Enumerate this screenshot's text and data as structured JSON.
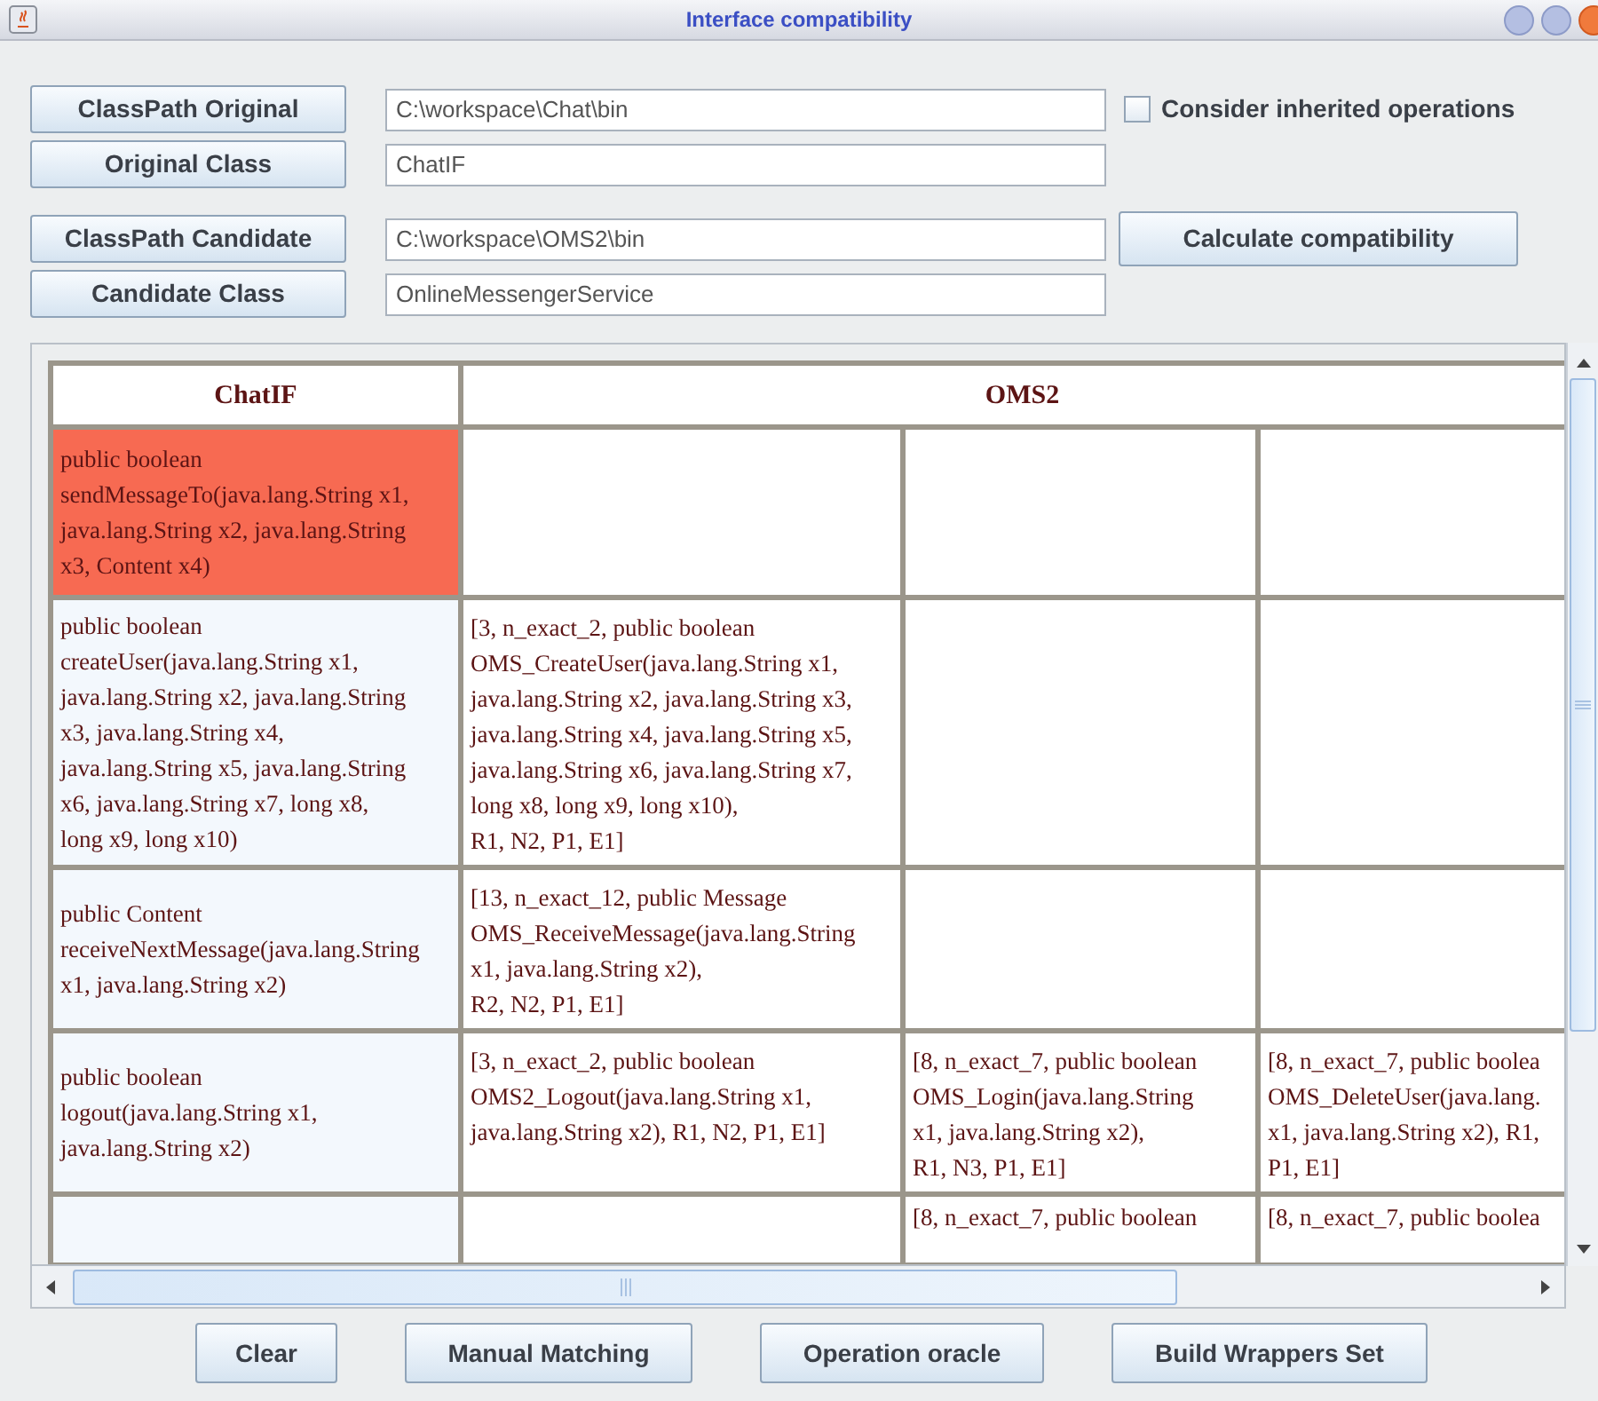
{
  "window": {
    "title": "Interface compatibility"
  },
  "form": [
    {
      "button": "ClassPath Original",
      "value": "C:\\workspace\\Chat\\bin"
    },
    {
      "button": "Original Class",
      "value": "ChatIF"
    },
    {
      "button": "ClassPath Candidate",
      "value": "C:\\workspace\\OMS2\\bin"
    },
    {
      "button": "Candidate Class",
      "value": "OnlineMessengerService"
    }
  ],
  "inherited_checkbox": {
    "label": "Consider inherited operations",
    "checked": false
  },
  "calculate_button": "Calculate compatibility",
  "table": {
    "original": "ChatIF",
    "candidate": "OMS2",
    "rows": [
      {
        "operation": {
          "lines": [
            "public boolean",
            "sendMessageTo(java.lang.String x1,",
            "java.lang.String x2, java.lang.String",
            "x3, Content x4)"
          ],
          "highlighted": true
        }
      },
      {
        "operation": {
          "lines": [
            "public boolean",
            "createUser(java.lang.String x1,",
            "java.lang.String x2, java.lang.String",
            "x3, java.lang.String x4,",
            "java.lang.String x5, java.lang.String",
            "x6, java.lang.String x7, long x8,",
            "long x9, long x10)"
          ],
          "highlighted": false
        },
        "column_2": {
          "lines": [
            "[3, n_exact_2, public boolean",
            "OMS_CreateUser(java.lang.String x1,",
            "java.lang.String x2, java.lang.String x3,",
            "java.lang.String x4, java.lang.String x5,",
            "java.lang.String x6, java.lang.String x7,",
            "long x8, long x9, long x10),",
            "R1, N2, P1, E1]"
          ]
        }
      },
      {
        "operation": {
          "lines": [
            "public  Content",
            "receiveNextMessage(java.lang.String",
            " x1, java.lang.String x2)"
          ],
          "highlighted": false
        },
        "column_2": {
          "lines": [
            "[13, n_exact_12, public Message",
            "OMS_ReceiveMessage(java.lang.String",
            " x1, java.lang.String x2),",
            "R2, N2, P1, E1]"
          ]
        }
      },
      {
        "operation": {
          "lines": [
            "public boolean",
            "logout(java.lang.String x1,",
            "java.lang.String x2)"
          ],
          "highlighted": false
        },
        "column_2": {
          "lines": [
            "[3, n_exact_2, public boolean",
            "OMS2_Logout(java.lang.String x1,",
            "java.lang.String x2), R1, N2, P1, E1]"
          ]
        },
        "column_3": {
          "lines": [
            "[8, n_exact_7, public boolean",
            "OMS_Login(java.lang.String",
            "x1, java.lang.String x2),",
            "R1, N3, P1, E1]"
          ]
        },
        "column_4": {
          "lines": [
            "[8, n_exact_7, public boolea",
            "OMS_DeleteUser(java.lang.",
            " x1, java.lang.String x2), R1,",
            "P1, E1]"
          ]
        }
      },
      {
        "column_3": {
          "lines": [
            "[8, n_exact_7, public boolean"
          ]
        },
        "column_4": {
          "lines": [
            "[8, n_exact_7, public boolea"
          ]
        }
      }
    ]
  },
  "actions": [
    "Clear",
    "Manual Matching",
    "Operation oracle",
    "Build Wrappers Set"
  ]
}
